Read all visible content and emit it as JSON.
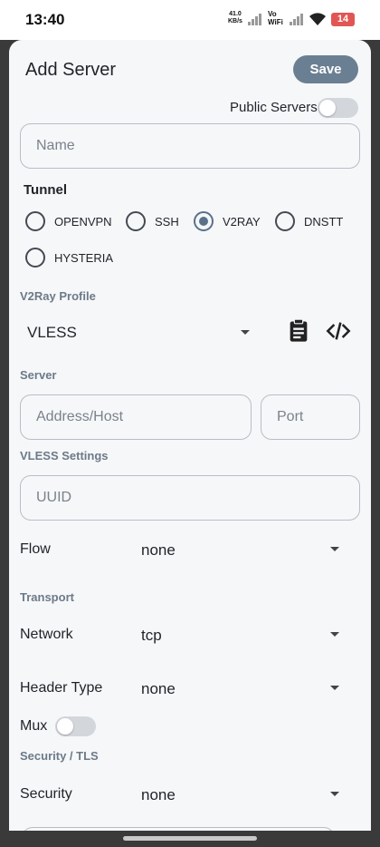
{
  "status": {
    "time": "13:40",
    "net_speed_value": "41.0",
    "net_speed_unit": "KB/s",
    "volte_top": "Vo",
    "volte_bottom": "WiFi",
    "battery": "14"
  },
  "dialog": {
    "title": "Add Server",
    "save_label": "Save",
    "public_servers_label": "Public Servers",
    "public_servers_on": false,
    "name_placeholder": "Name"
  },
  "tunnel": {
    "label": "Tunnel",
    "options": [
      "OPENVPN",
      "SSH",
      "V2RAY",
      "DNSTT",
      "HYSTERIA"
    ],
    "selected": "V2RAY"
  },
  "v2ray_profile": {
    "label": "V2Ray Profile",
    "value": "VLESS"
  },
  "server": {
    "label": "Server",
    "address_placeholder": "Address/Host",
    "port_placeholder": "Port"
  },
  "vless_settings": {
    "label": "VLESS Settings",
    "uuid_placeholder": "UUID",
    "flow_label": "Flow",
    "flow_value": "none"
  },
  "transport": {
    "label": "Transport",
    "network_label": "Network",
    "network_value": "tcp",
    "header_type_label": "Header Type",
    "header_type_value": "none",
    "mux_label": "Mux",
    "mux_on": false
  },
  "security_tls": {
    "label": "Security / TLS",
    "security_label": "Security",
    "security_value": "none"
  },
  "icons": {
    "paste": "clipboard-icon",
    "code": "code-icon",
    "dropdown": "chevron-down-icon"
  },
  "colors": {
    "accent": "#59728a",
    "save_button": "#6b7f92",
    "battery": "#e25555"
  }
}
